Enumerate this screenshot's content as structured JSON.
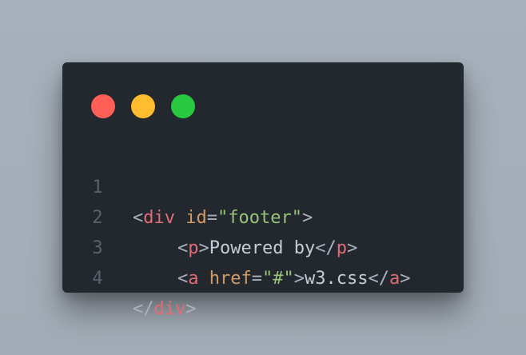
{
  "colors": {
    "page_background": "#a7b1bb",
    "window_background": "#23272e",
    "close_dot": "#ff5f57",
    "minimize_dot": "#febc2e",
    "zoom_dot": "#28c840",
    "line_number": "#5b616b",
    "punctuation": "#abb2bf",
    "tag": "#e06c75",
    "attribute": "#d19a66",
    "string": "#98c379",
    "plain_text": "#c8ccd4"
  },
  "window_dots": [
    {
      "name": "close",
      "icon": "red-circle"
    },
    {
      "name": "minimize",
      "icon": "yellow-circle"
    },
    {
      "name": "zoom",
      "icon": "green-circle"
    }
  ],
  "code": {
    "language": "html",
    "lines": [
      {
        "number": "1",
        "tokens": {
          "open_bracket": "<",
          "tag": "div",
          "space": " ",
          "attr": "id",
          "equals": "=",
          "value": "\"footer\"",
          "close_bracket": ">"
        }
      },
      {
        "number": "2",
        "tokens": {
          "open_bracket": "<",
          "tag": "p",
          "mid_bracket": ">",
          "text": "Powered by",
          "end_open": "</",
          "end_tag": "p",
          "close_bracket": ">"
        }
      },
      {
        "number": "3",
        "tokens": {
          "open_bracket": "<",
          "tag": "a",
          "space": " ",
          "attr": "href",
          "equals": "=",
          "value": "\"#\"",
          "mid_bracket": ">",
          "text": "w3.css",
          "end_open": "</",
          "end_tag": "a",
          "close_bracket": ">"
        }
      },
      {
        "number": "4",
        "tokens": {
          "end_open": "</",
          "end_tag": "div",
          "close_bracket": ">"
        }
      }
    ]
  }
}
